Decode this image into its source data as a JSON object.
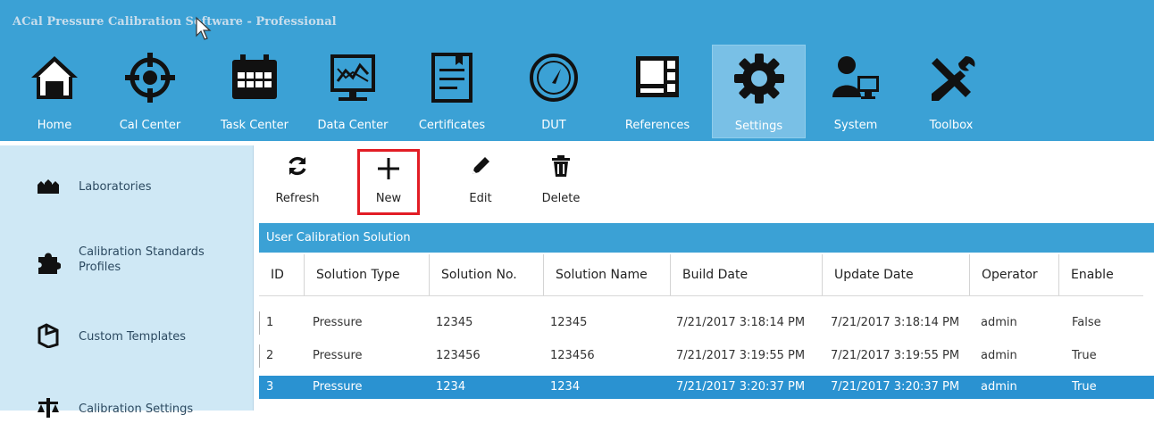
{
  "app_title": "ACal Pressure Calibration Software - Professional",
  "nav": [
    {
      "label": "Home",
      "icon": "home-icon"
    },
    {
      "label": "Cal Center",
      "icon": "crosshair-icon"
    },
    {
      "label": "Task Center",
      "icon": "calendar-icon"
    },
    {
      "label": "Data Center",
      "icon": "chart-monitor-icon"
    },
    {
      "label": "Certificates",
      "icon": "certificate-icon"
    },
    {
      "label": "DUT",
      "icon": "gauge-icon"
    },
    {
      "label": "References",
      "icon": "reference-device-icon"
    },
    {
      "label": "Settings",
      "icon": "gear-icon",
      "active": true
    },
    {
      "label": "System",
      "icon": "users-icon"
    },
    {
      "label": "Toolbox",
      "icon": "tools-icon"
    }
  ],
  "sidebar": [
    {
      "label": "Laboratories",
      "icon": "laboratories-icon"
    },
    {
      "label": "Calibration Standards Profiles",
      "icon": "puzzle-icon"
    },
    {
      "label": "Custom Templates",
      "icon": "template-icon"
    },
    {
      "label": "Calibration Settings",
      "icon": "scale-icon"
    }
  ],
  "toolbar": {
    "refresh": "Refresh",
    "new": "New",
    "edit": "Edit",
    "delete": "Delete"
  },
  "panel_title": "User Calibration Solution",
  "table": {
    "columns": [
      "ID",
      "Solution Type",
      "Solution No.",
      "Solution Name",
      "Build Date",
      "Update Date",
      "Operator",
      "Enable"
    ],
    "rows": [
      [
        "1",
        "Pressure",
        "12345",
        "12345",
        "7/21/2017 3:18:14 PM",
        "7/21/2017 3:18:14 PM",
        "admin",
        "False"
      ],
      [
        "2",
        "Pressure",
        "123456",
        "123456",
        "7/21/2017 3:19:55 PM",
        "7/21/2017 3:19:55 PM",
        "admin",
        "True"
      ],
      [
        "3",
        "Pressure",
        "1234",
        "1234",
        "7/21/2017 3:20:37 PM",
        "7/21/2017 3:20:37 PM",
        "admin",
        "True"
      ]
    ],
    "selected_row": 3
  },
  "colors": {
    "header_blue": "#3ba1d5",
    "sidebar_bg": "#cfe8f5",
    "selected_row": "#2a92d1",
    "highlight_border": "#e21d25"
  }
}
